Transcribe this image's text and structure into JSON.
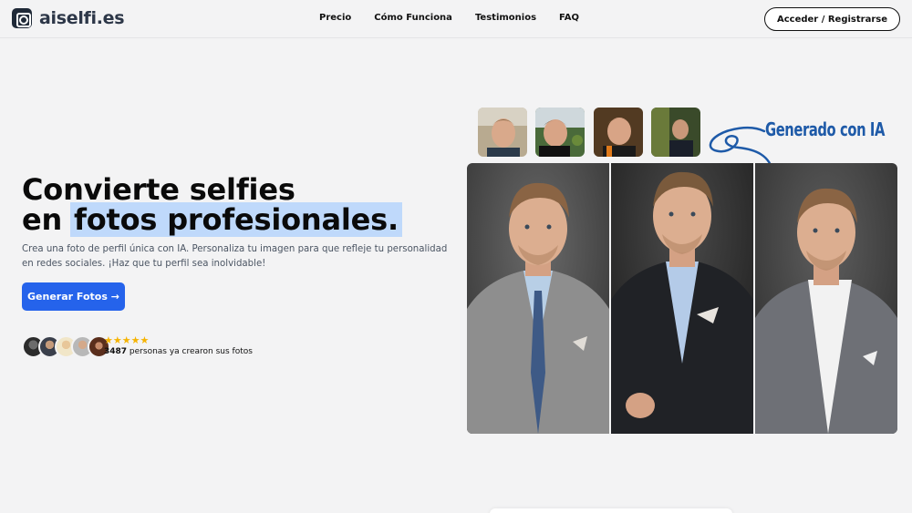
{
  "brand": {
    "name": "aiselfi.es",
    "icon": "camera-logo-icon"
  },
  "nav": {
    "items": [
      "Precio",
      "Cómo Funciona",
      "Testimonios",
      "FAQ"
    ]
  },
  "header": {
    "login_label": "Acceder / Registrarse"
  },
  "hero": {
    "title_line1": "Convierte selfies",
    "title_line2_prefix": "en ",
    "title_line2_highlight": "fotos profesionales.",
    "description": "Crea una foto de perfil única con IA. Personaliza tu imagen para que refleje tu personalidad en redes sociales. ¡Haz que tu perfil sea inolvidable!",
    "cta_label": "Generar Fotos →",
    "rating_stars": "★★★★★",
    "rating": 5,
    "users_count": "3487",
    "users_text": " personas ya crearon sus fotos"
  },
  "showcase": {
    "generated_label": "Generado con IA"
  },
  "colors": {
    "accent": "#2563eb",
    "highlight": "#bfd9fb",
    "label_blue": "#1e5aa8",
    "star": "#f5b301",
    "background": "#f3f3f4"
  }
}
